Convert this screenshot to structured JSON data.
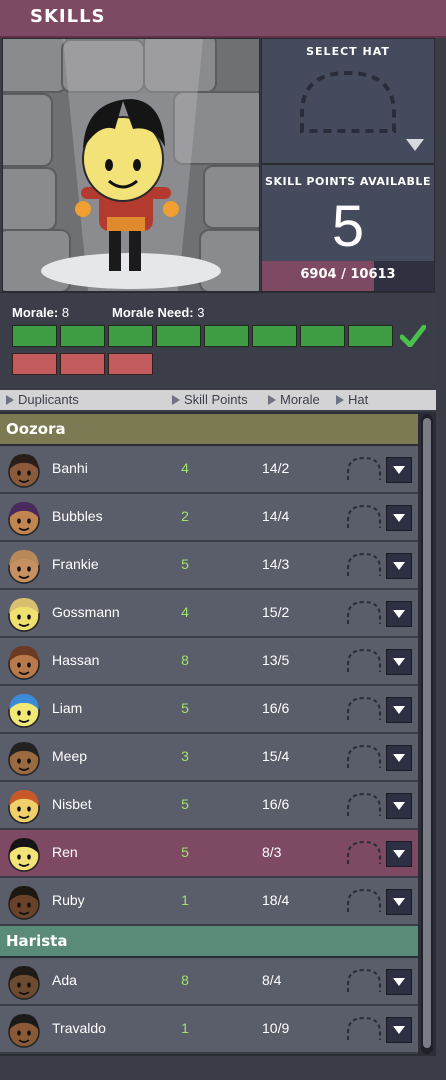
{
  "window": {
    "title": "SKILLS"
  },
  "hat_panel": {
    "label": "SELECT HAT"
  },
  "skill_points": {
    "label": "SKILL POINTS AVAILABLE",
    "value": "5",
    "xp_text": "6904 / 10613",
    "xp_fraction": 0.65
  },
  "morale": {
    "morale_label": "Morale:",
    "morale_value": "8",
    "need_label": "Morale Need:",
    "need_value": "3",
    "green_boxes": 8,
    "red_boxes": 3,
    "status": "check-icon"
  },
  "columns": {
    "duplicants": "Duplicants",
    "skill_points": "Skill Points",
    "morale": "Morale",
    "hat": "Hat"
  },
  "groups": [
    {
      "name": "Oozora",
      "color": "#7b7a52",
      "members": [
        {
          "name": "Banhi",
          "skill_points": "4",
          "morale": "14/2",
          "hair": "#2a1e1a",
          "skin": "#8b5a3a"
        },
        {
          "name": "Bubbles",
          "skill_points": "2",
          "morale": "14/4",
          "hair": "#4a2a5c",
          "skin": "#c08550"
        },
        {
          "name": "Frankie",
          "skill_points": "5",
          "morale": "14/3",
          "hair": "#b88a5a",
          "skin": "#c69060"
        },
        {
          "name": "Gossmann",
          "skill_points": "4",
          "morale": "15/2",
          "hair": "#d8c070",
          "skin": "#f0e070"
        },
        {
          "name": "Hassan",
          "skill_points": "8",
          "morale": "13/5",
          "hair": "#6a3a22",
          "skin": "#b87a4a"
        },
        {
          "name": "Liam",
          "skill_points": "5",
          "morale": "16/6",
          "hair": "#3a8ad8",
          "skin": "#f2e878"
        },
        {
          "name": "Meep",
          "skill_points": "3",
          "morale": "15/4",
          "hair": "#222222",
          "skin": "#9a6a40"
        },
        {
          "name": "Nisbet",
          "skill_points": "5",
          "morale": "16/6",
          "hair": "#c85a2a",
          "skin": "#f0d06a"
        },
        {
          "name": "Ren",
          "skill_points": "5",
          "morale": "8/3",
          "hair": "#151515",
          "skin": "#f3e277",
          "selected": true
        },
        {
          "name": "Ruby",
          "skill_points": "1",
          "morale": "18/4",
          "hair": "#1e1812",
          "skin": "#6a4228"
        }
      ]
    },
    {
      "name": "Harista",
      "color": "#5a8a78",
      "members": [
        {
          "name": "Ada",
          "skill_points": "8",
          "morale": "8/4",
          "hair": "#1e1a16",
          "skin": "#6e4a2e"
        },
        {
          "name": "Travaldo",
          "skill_points": "1",
          "morale": "10/9",
          "hair": "#1a1a1a",
          "skin": "#8a5a36"
        }
      ]
    }
  ]
}
